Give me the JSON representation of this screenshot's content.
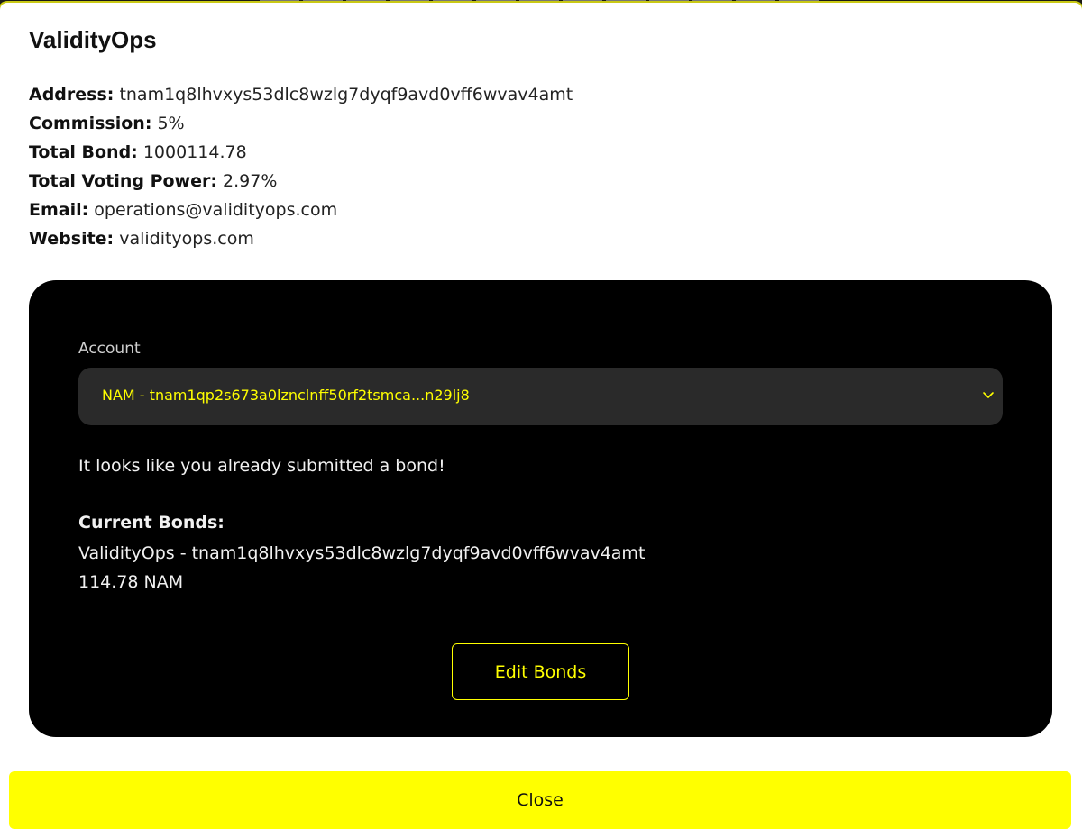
{
  "validator": {
    "name": "ValidityOps",
    "fields": [
      {
        "label": "Address:",
        "value": "tnam1q8lhvxys53dlc8wzlg7dyqf9avd0vff6wvav4amt"
      },
      {
        "label": "Commission:",
        "value": "5%"
      },
      {
        "label": "Total Bond:",
        "value": "1000114.78"
      },
      {
        "label": "Total Voting Power:",
        "value": "2.97%"
      },
      {
        "label": "Email:",
        "value": "operations@validityops.com"
      },
      {
        "label": "Website:",
        "value": "validityops.com"
      }
    ]
  },
  "bond_panel": {
    "account_label": "Account",
    "account_selected": "NAM - tnam1qp2s673a0lznclnff50rf2tsmca...n29lj8",
    "notice": "It looks like you already submitted a bond!",
    "current_bonds_heading": "Current Bonds:",
    "current_bonds": [
      {
        "validator_line": "ValidityOps - tnam1q8lhvxys53dlc8wzlg7dyqf9avd0vff6wvav4amt",
        "amount": "114.78 NAM"
      }
    ],
    "edit_button_label": "Edit Bonds"
  },
  "close_button_label": "Close",
  "colors": {
    "accent": "#ffff00",
    "panel_bg": "#000000",
    "select_bg": "#2a2a2a",
    "modal_bg": "#ffffff"
  },
  "icons": {
    "select_chevron": "chevron-down-icon"
  }
}
